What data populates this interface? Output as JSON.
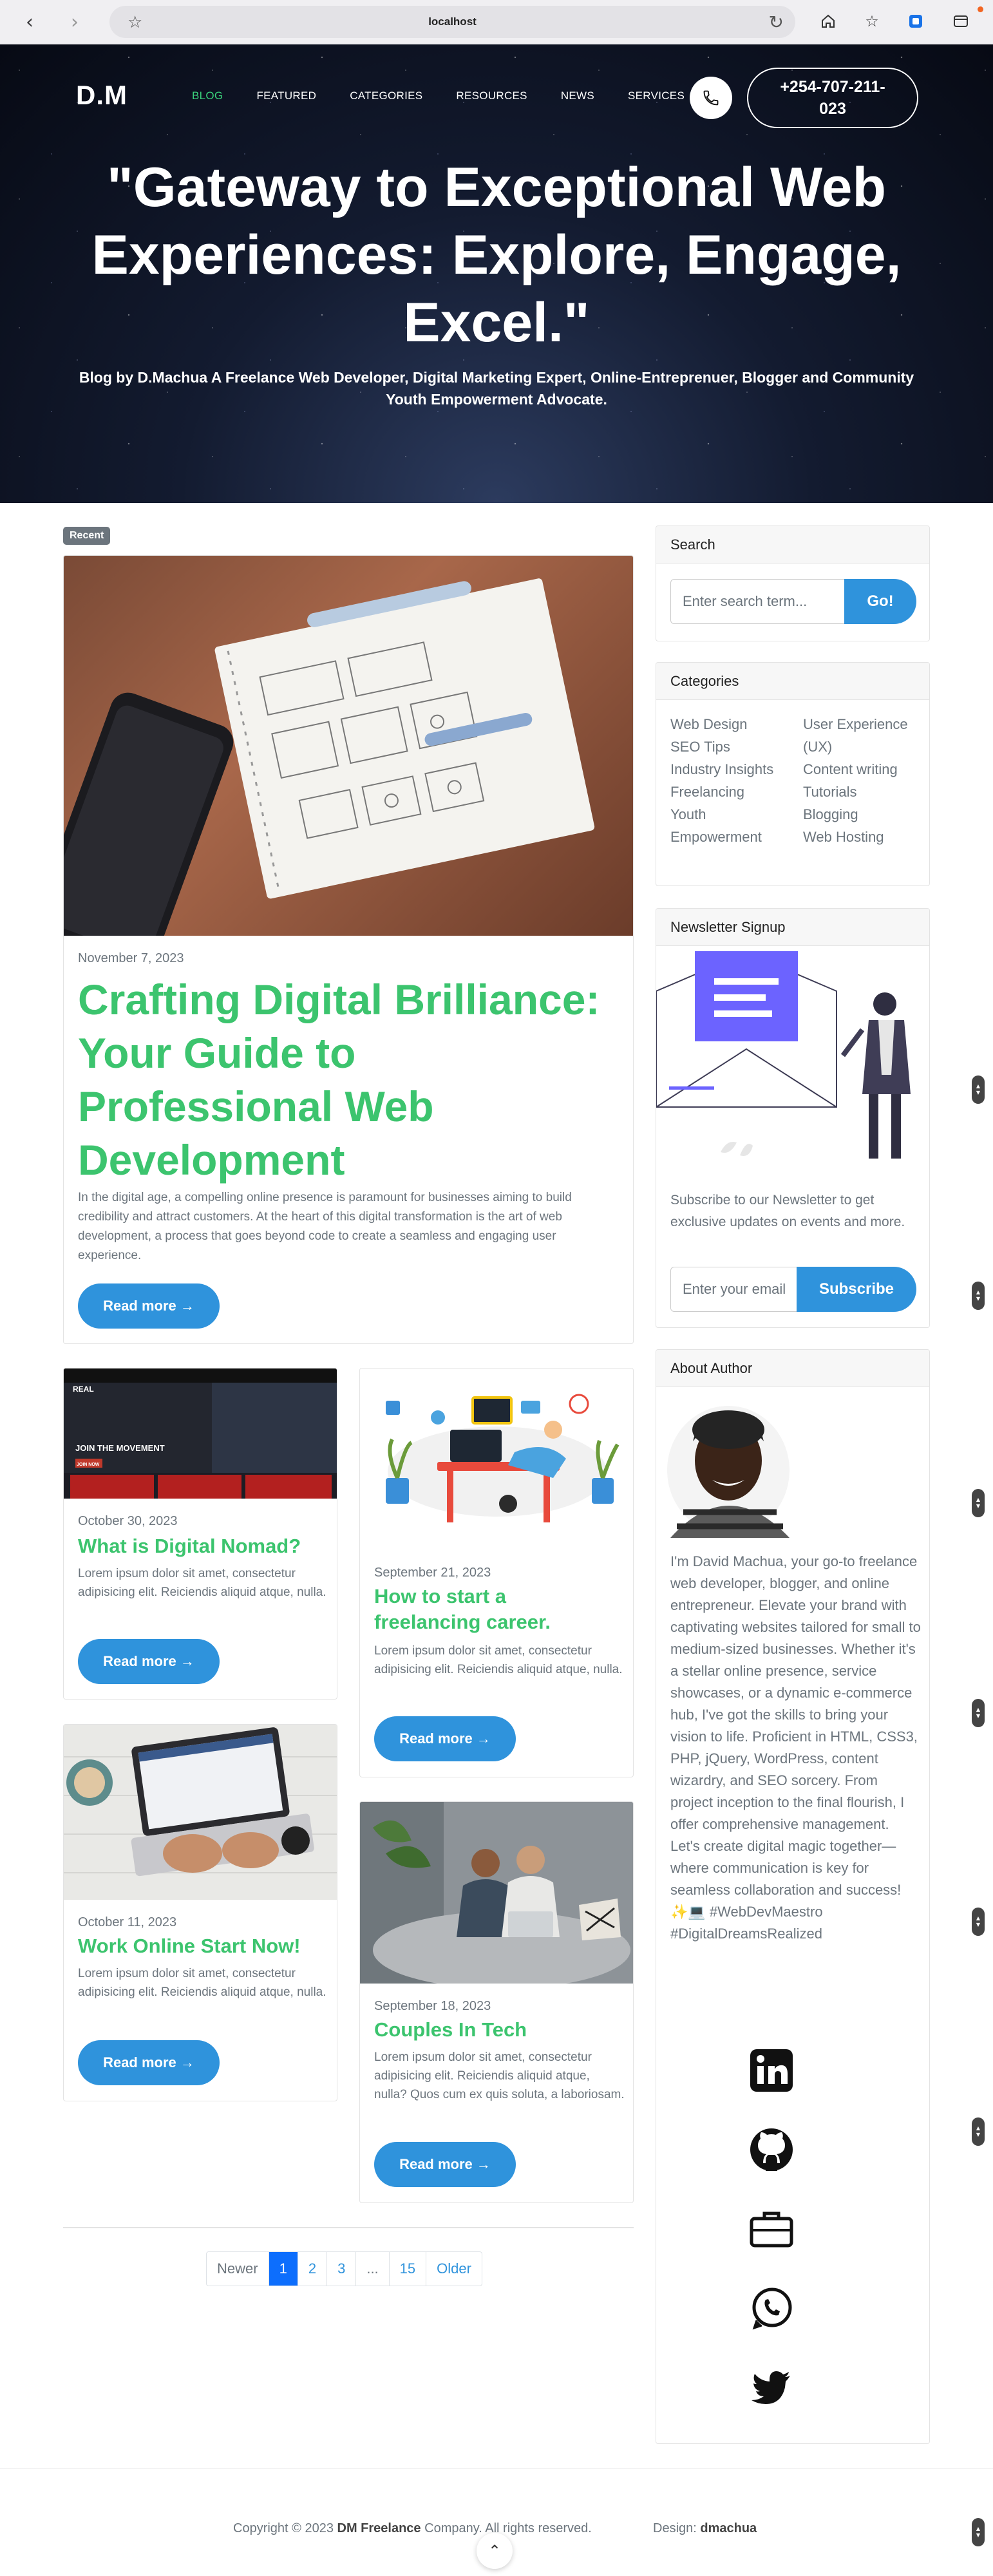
{
  "browser": {
    "url": "localhost",
    "back_icon": "chevron-left-icon",
    "forward_icon": "chevron-right-icon"
  },
  "header": {
    "brand": "D.M",
    "nav": [
      "BLOG",
      "FEATURED",
      "CATEGORIES",
      "RESOURCES",
      "NEWS",
      "SERVICES"
    ],
    "active_nav": "BLOG",
    "phone": "+254-707-211-023",
    "accent_color": "#3ad07a"
  },
  "hero": {
    "title": "\"Gateway to Exceptional Web Experiences: Explore, Engage, Excel.\"",
    "subtitle": "Blog by D.Machua A Freelance Web Developer, Digital Marketing Expert, Online-Entreprenuer, Blogger and Community Youth Empowerment Advocate."
  },
  "featured": {
    "badge": "Recent",
    "date": "November 7, 2023",
    "title": "Crafting Digital Brilliance: Your Guide to Professional Web Development",
    "excerpt": "In the digital age, a compelling online presence is paramount for businesses aiming to build credibility and attract customers. At the heart of this digital transformation is the art of web development, a process that goes beyond code to create a seamless and engaging user experience.",
    "button": "Read more →"
  },
  "posts": [
    {
      "date": "October 30, 2023",
      "title": "What is Digital Nomad?",
      "excerpt": "Lorem ipsum dolor sit amet, consectetur adipisicing elit. Reiciendis aliquid atque, nulla.",
      "button": "Read more →"
    },
    {
      "date": "September 21, 2023",
      "title": "How to start a freelancing career.",
      "excerpt": "Lorem ipsum dolor sit amet, consectetur adipisicing elit. Reiciendis aliquid atque, nulla.",
      "button": "Read more →"
    },
    {
      "date": "October 11, 2023",
      "title": "Work Online Start Now!",
      "excerpt": "Lorem ipsum dolor sit amet, consectetur adipisicing elit. Reiciendis aliquid atque, nulla.",
      "button": "Read more →"
    },
    {
      "date": "September 18, 2023",
      "title": "Couples In Tech",
      "excerpt": "Lorem ipsum dolor sit amet, consectetur adipisicing elit. Reiciendis aliquid atque, nulla? Quos cum ex quis soluta, a laboriosam.",
      "button": "Read more →"
    }
  ],
  "thumb_texts": {
    "brand": "REAL",
    "headline": "JOIN THE MOVEMENT",
    "cta": "JOIN NOW"
  },
  "pagination": {
    "items": [
      "Newer",
      "1",
      "2",
      "3",
      "...",
      "15",
      "Older"
    ],
    "current": "1"
  },
  "sidebar": {
    "search": {
      "title": "Search",
      "placeholder": "Enter search term...",
      "button": "Go!"
    },
    "categories": {
      "title": "Categories",
      "left": [
        "Web Design",
        "SEO Tips",
        "Industry Insights",
        "Freelancing",
        "Youth Empowerment"
      ],
      "right": [
        "User Experience (UX)",
        "Content writing",
        "Tutorials",
        "Blogging",
        "Web Hosting"
      ]
    },
    "newsletter": {
      "title": "Newsletter Signup",
      "text": "Subscribe to our Newsletter to get exclusive updates on events and more.",
      "placeholder": "Enter your email",
      "button": "Subscribe"
    },
    "about": {
      "title": "About Author",
      "text": "I'm David Machua, your go-to freelance web developer, blogger, and online entrepreneur. Elevate your brand with captivating websites tailored for small to medium-sized businesses. Whether it's a stellar online presence, service showcases, or a dynamic e-commerce hub, I've got the skills to bring your vision to life. Proficient in HTML, CSS3, PHP, jQuery, WordPress, content wizardry, and SEO sorcery. From project inception to the final flourish, I offer comprehensive management. Let's create digital magic together—where communication is key for seamless collaboration and success! ✨💻 #WebDevMaestro #DigitalDreamsRealized",
      "social_icons": [
        "linkedin-icon",
        "github-icon",
        "briefcase-icon",
        "whatsapp-icon",
        "twitter-icon"
      ]
    }
  },
  "footer": {
    "copyright_pre": "Copyright © 2023",
    "company": "DM Freelance",
    "copyright_post": "Company. All rights reserved.",
    "design_label": "Design:",
    "designer": "dmachua"
  }
}
